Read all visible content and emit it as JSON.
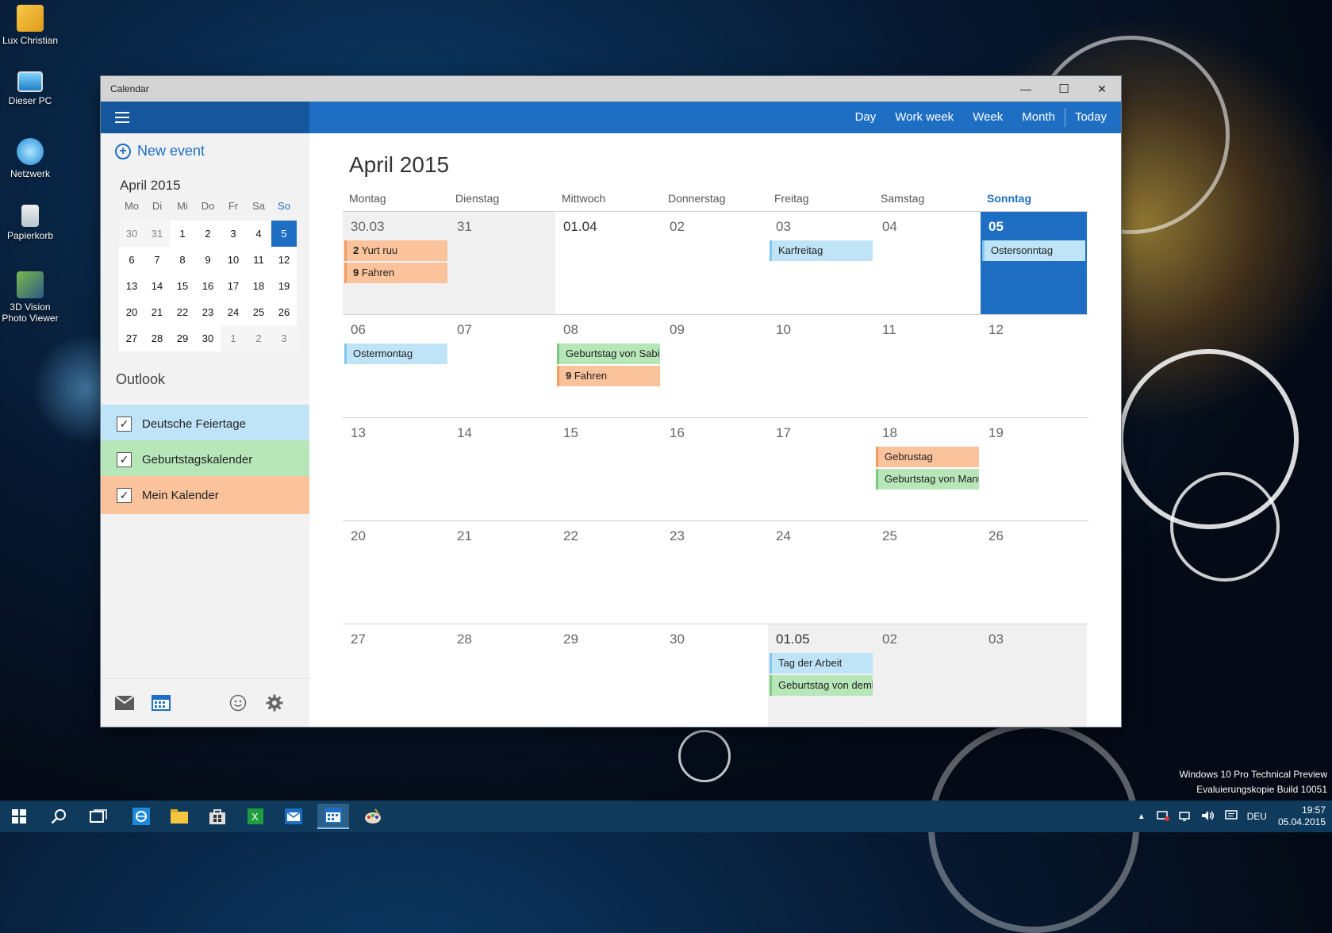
{
  "desktop": {
    "icons": [
      {
        "label": "Lux Christian"
      },
      {
        "label": "Dieser PC"
      },
      {
        "label": "Netzwerk"
      },
      {
        "label": "Papierkorb"
      },
      {
        "label": "3D Vision Photo Viewer"
      }
    ],
    "watermark_line1": "Windows 10 Pro Technical Preview",
    "watermark_line2": "Evaluierungskopie Build 10051"
  },
  "window": {
    "title": "Calendar",
    "minimize": "—",
    "maximize": "☐",
    "close": "✕"
  },
  "toolbar": {
    "views": [
      "Day",
      "Work week",
      "Week",
      "Month"
    ],
    "today_label": "Today"
  },
  "sidebar": {
    "new_event_label": "New event",
    "mini_calendar": {
      "title": "April 2015",
      "weekdays": [
        "Mo",
        "Di",
        "Mi",
        "Do",
        "Fr",
        "Sa",
        "So"
      ],
      "days": [
        "30",
        "31",
        "1",
        "2",
        "3",
        "4",
        "5",
        "6",
        "7",
        "8",
        "9",
        "10",
        "11",
        "12",
        "13",
        "14",
        "15",
        "16",
        "17",
        "18",
        "19",
        "20",
        "21",
        "22",
        "23",
        "24",
        "25",
        "26",
        "27",
        "28",
        "29",
        "30",
        "1",
        "2",
        "3"
      ]
    },
    "account_title": "Outlook",
    "calendars": [
      {
        "label": "Deutsche Feiertage",
        "color": "#bfe4f7",
        "checked": true
      },
      {
        "label": "Geburtstagskalender",
        "color": "#b7e6b9",
        "checked": true
      },
      {
        "label": "Mein Kalender",
        "color": "#fbc39b",
        "checked": true
      }
    ],
    "footer_icons": [
      "mail-icon",
      "calendar-icon",
      "smiley-icon",
      "gear-icon"
    ]
  },
  "main": {
    "month_title": "April 2015",
    "weekday_headers": [
      "Montag",
      "Dienstag",
      "Mittwoch",
      "Donnerstag",
      "Freitag",
      "Samstag",
      "Sonntag"
    ],
    "weeks": [
      [
        {
          "num": "30.03",
          "gray": true,
          "events": [
            {
              "title": "Yurt ruu",
              "prefix": "2",
              "color": "orange"
            },
            {
              "title": "Fahren",
              "prefix": "9",
              "color": "orange"
            }
          ]
        },
        {
          "num": "31",
          "gray": true,
          "events": []
        },
        {
          "num": "01.04",
          "current": true,
          "events": []
        },
        {
          "num": "02",
          "events": []
        },
        {
          "num": "03",
          "events": [
            {
              "title": "Karfreitag",
              "color": "blue"
            }
          ]
        },
        {
          "num": "04",
          "events": []
        },
        {
          "num": "05",
          "today": true,
          "events": [
            {
              "title": "Ostersonntag",
              "color": "blue"
            }
          ]
        }
      ],
      [
        {
          "num": "06",
          "events": [
            {
              "title": "Ostermontag",
              "color": "blue"
            }
          ]
        },
        {
          "num": "07",
          "events": []
        },
        {
          "num": "08",
          "events": [
            {
              "title": "Geburtstag von Sabir",
              "color": "green"
            },
            {
              "title": "Fahren",
              "prefix": "9",
              "color": "orange"
            }
          ]
        },
        {
          "num": "09",
          "events": []
        },
        {
          "num": "10",
          "events": []
        },
        {
          "num": "11",
          "events": []
        },
        {
          "num": "12",
          "events": []
        }
      ],
      [
        {
          "num": "13",
          "events": []
        },
        {
          "num": "14",
          "events": []
        },
        {
          "num": "15",
          "events": []
        },
        {
          "num": "16",
          "events": []
        },
        {
          "num": "17",
          "events": []
        },
        {
          "num": "18",
          "events": [
            {
              "title": "Gebrustag",
              "color": "orange"
            },
            {
              "title": "Geburtstag von Manu",
              "color": "green"
            }
          ]
        },
        {
          "num": "19",
          "events": []
        }
      ],
      [
        {
          "num": "20",
          "events": []
        },
        {
          "num": "21",
          "events": []
        },
        {
          "num": "22",
          "events": []
        },
        {
          "num": "23",
          "events": []
        },
        {
          "num": "24",
          "events": []
        },
        {
          "num": "25",
          "events": []
        },
        {
          "num": "26",
          "events": []
        }
      ],
      [
        {
          "num": "27",
          "events": []
        },
        {
          "num": "28",
          "events": []
        },
        {
          "num": "29",
          "events": []
        },
        {
          "num": "30",
          "events": []
        },
        {
          "num": "01.05",
          "gray": true,
          "current": true,
          "events": [
            {
              "title": "Tag der Arbeit",
              "color": "blue"
            },
            {
              "title": "Geburtstag von demb",
              "color": "green"
            }
          ]
        },
        {
          "num": "02",
          "gray": true,
          "events": []
        },
        {
          "num": "03",
          "gray": true,
          "events": []
        }
      ]
    ]
  },
  "taskbar": {
    "language": "DEU",
    "time": "19:57",
    "date": "05.04.2015"
  },
  "colors": {
    "accent": "#1e6fc4",
    "accent_dark": "#15569c"
  }
}
